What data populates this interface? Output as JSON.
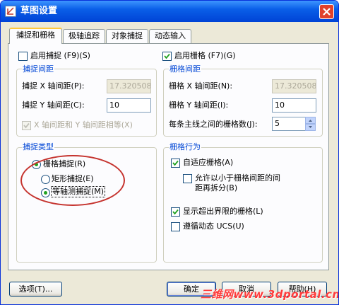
{
  "title": "草图设置",
  "tabs": [
    {
      "label": "捕捉和栅格",
      "active": true
    },
    {
      "label": "极轴追踪",
      "active": false
    },
    {
      "label": "对象捕捉",
      "active": false
    },
    {
      "label": "动态输入",
      "active": false
    }
  ],
  "snap_on": {
    "label": "启用捕捉 (F9)(S)",
    "checked": false
  },
  "grid_on": {
    "label": "启用栅格 (F7)(G)",
    "checked": true
  },
  "snap_spacing": {
    "title": "捕捉间距",
    "x_label": "捕捉 X 轴间距(P):",
    "x_value": "17.3205080",
    "y_label": "捕捉 Y 轴间距(C):",
    "y_value": "10",
    "equal_label": "X 轴间距和 Y 轴间距相等(X)",
    "equal_checked": true
  },
  "grid_spacing": {
    "title": "栅格间距",
    "x_label": "栅格 X 轴间距(N):",
    "x_value": "17.3205080",
    "y_label": "栅格 Y 轴间距(I):",
    "y_value": "10",
    "major_label": "每条主线之间的栅格数(J):",
    "major_value": "5"
  },
  "snap_type": {
    "title": "捕捉类型",
    "grid_snap": "栅格捕捉(R)",
    "rect_snap": "矩形捕捉(E)",
    "iso_snap": "等轴测捕捉(M)",
    "selected": "iso_snap"
  },
  "grid_behavior": {
    "title": "栅格行为",
    "adaptive": {
      "label": "自适应栅格(A)",
      "checked": true
    },
    "subdivide": {
      "label_line1": "允许以小于栅格间距的间",
      "label_line2": "距再拆分(B)",
      "checked": false
    },
    "beyond_limits": {
      "label": "显示超出界限的栅格(L)",
      "checked": true
    },
    "follow_ucs": {
      "label": "遵循动态 UCS(U)",
      "checked": false
    }
  },
  "buttons": {
    "options": "选项(T)...",
    "ok": "确定",
    "cancel": "取消",
    "help": "帮助(H)"
  },
  "watermark": "三维网www.3dportal.cn",
  "colors": {
    "titlebar": "#0a5fe8",
    "group_title": "#0046d5",
    "annotation_ring": "#c5332e"
  }
}
